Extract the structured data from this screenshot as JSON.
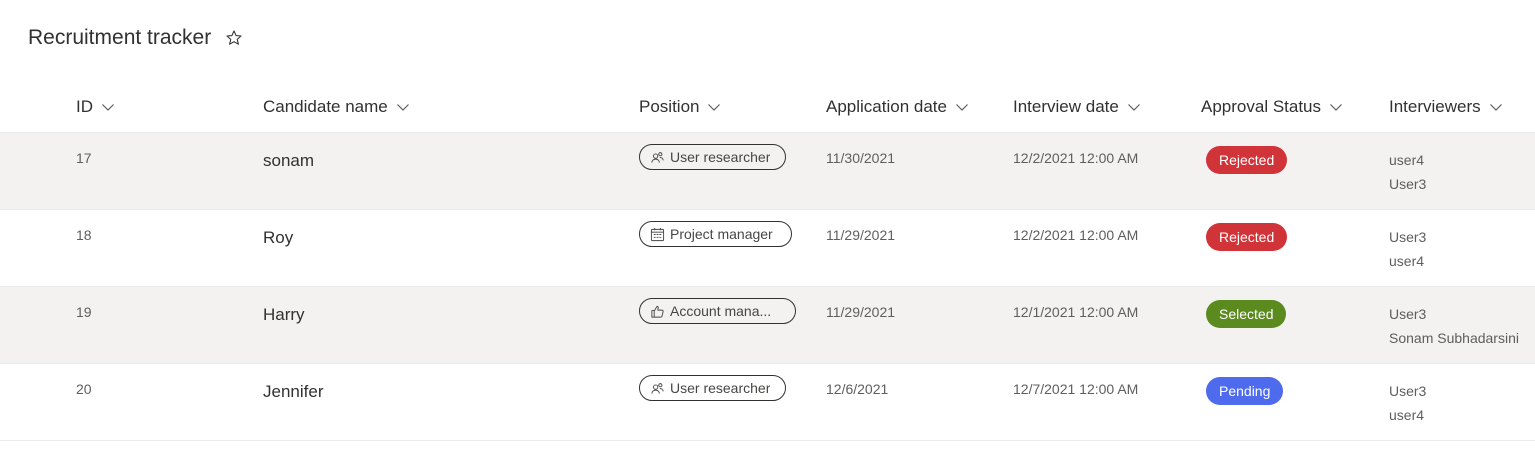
{
  "page": {
    "title": "Recruitment tracker",
    "favorite_icon": "star-icon"
  },
  "columns": {
    "id": "ID",
    "candidate": "Candidate name",
    "position": "Position",
    "application_date": "Application date",
    "interview_date": "Interview date",
    "approval_status": "Approval Status",
    "interviewers": "Interviewers"
  },
  "rows": [
    {
      "id": "17",
      "name": "sonam",
      "position": "User researcher",
      "position_icon": "people-icon",
      "application_date": "11/30/2021",
      "interview_date": "12/2/2021 12:00 AM",
      "status": "Rejected",
      "status_color": "#d13438",
      "interviewers": [
        "user4",
        "User3"
      ]
    },
    {
      "id": "18",
      "name": "Roy",
      "position": "Project manager",
      "position_icon": "calendar-icon",
      "application_date": "11/29/2021",
      "interview_date": "12/2/2021 12:00 AM",
      "status": "Rejected",
      "status_color": "#d13438",
      "interviewers": [
        "User3",
        "user4"
      ]
    },
    {
      "id": "19",
      "name": "Harry",
      "position": "Account mana...",
      "position_icon": "thumbs-up-icon",
      "application_date": "11/29/2021",
      "interview_date": "12/1/2021 12:00 AM",
      "status": "Selected",
      "status_color": "#5b8a1f",
      "interviewers": [
        "User3",
        "Sonam Subhadarsini"
      ]
    },
    {
      "id": "20",
      "name": "Jennifer",
      "position": "User researcher",
      "position_icon": "people-icon",
      "application_date": "12/6/2021",
      "interview_date": "12/7/2021 12:00 AM",
      "status": "Pending",
      "status_color": "#4f6bed",
      "interviewers": [
        "User3",
        "user4"
      ]
    }
  ]
}
